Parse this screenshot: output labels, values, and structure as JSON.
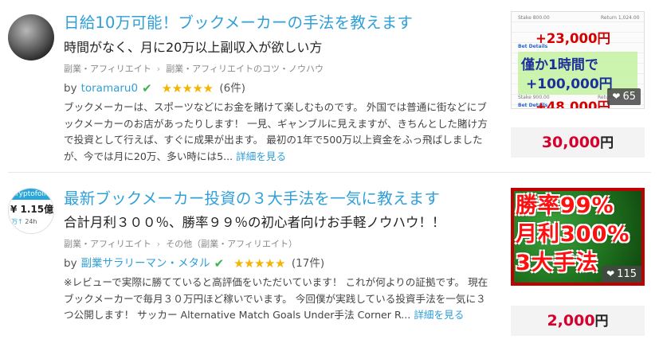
{
  "listings": [
    {
      "title": "日給10万可能！ブックメーカーの手法を教えます",
      "subtitle": "時間がなく、月に20万以上副収入が欲しい方",
      "breadcrumb": [
        "副業・アフィリエイト",
        "副業・アフィリエイトのコツ・ノウハウ"
      ],
      "by_label": "by",
      "author": "toramaru0",
      "rating_stars": 5,
      "review_count": "(6件)",
      "description": "ブックメーカーは、スポーツなどにお金を賭けて楽しむものです。 外国では普通に街などにブックメーカーのお店があったりします！ 一見、ギャンブルに見えますが、きちんとした賭け方で投資として行えば、すぐに成果が出ます。 最初の1年で500万以上資金をふっ飛ばしましたが、今では月に20万、多い時には5...",
      "more_label": "詳細を見る",
      "thumbnail": {
        "lines": [
          "+23,000円",
          "僅か1時間で",
          "+100,000円",
          "+48,000円"
        ],
        "small_texts": [
          "Stake 800.00",
          "Return 1,024.00",
          "Bet Details",
          "Stake 900.00",
          "Return 1,377.00",
          "Bet Details"
        ]
      },
      "favorites": "65",
      "price": "30,000",
      "price_unit": "円"
    },
    {
      "title": "最新ブックメーカー投資の３大手法を一気に教えます",
      "subtitle": "合計月利３００％、勝率９９％の初心者向けお手軽ノウハウ！！",
      "breadcrumb": [
        "副業・アフィリエイト",
        "その他（副業・アフィリエイト）"
      ],
      "by_label": "by",
      "author": "副業サラリーマン・メタル",
      "rating_stars": 5,
      "review_count": "(17件)",
      "description": "※レビューで実際に勝てていると高評価をいただいています！ これが何よりの証拠です。 現在ブックメーカーで毎月３０万円ほど稼いでいます。 今回僕が実践している投資手法を一気に３つ公開します！ サッカー Alternative Match Goals Under手法 Corner R...",
      "more_label": "詳細を見る",
      "avatar": {
        "top": "cryptofolio",
        "mid": "¥ 1.15億",
        "bot_arrow": "万↑",
        "bot_time": "24h"
      },
      "thumbnail": {
        "lines": [
          "勝率99%",
          "月利300%",
          "3大手法"
        ]
      },
      "favorites": "115",
      "price": "2,000",
      "price_unit": "円"
    }
  ],
  "colors": {
    "title": "#2f9fd8",
    "price": "#d6002f",
    "star": "#f5b400",
    "check": "#3fb34f"
  },
  "icons": {
    "verified": "check-icon",
    "star": "star-icon",
    "favorite": "heart-icon",
    "breadcrumb_sep": "chevron-right-icon"
  }
}
